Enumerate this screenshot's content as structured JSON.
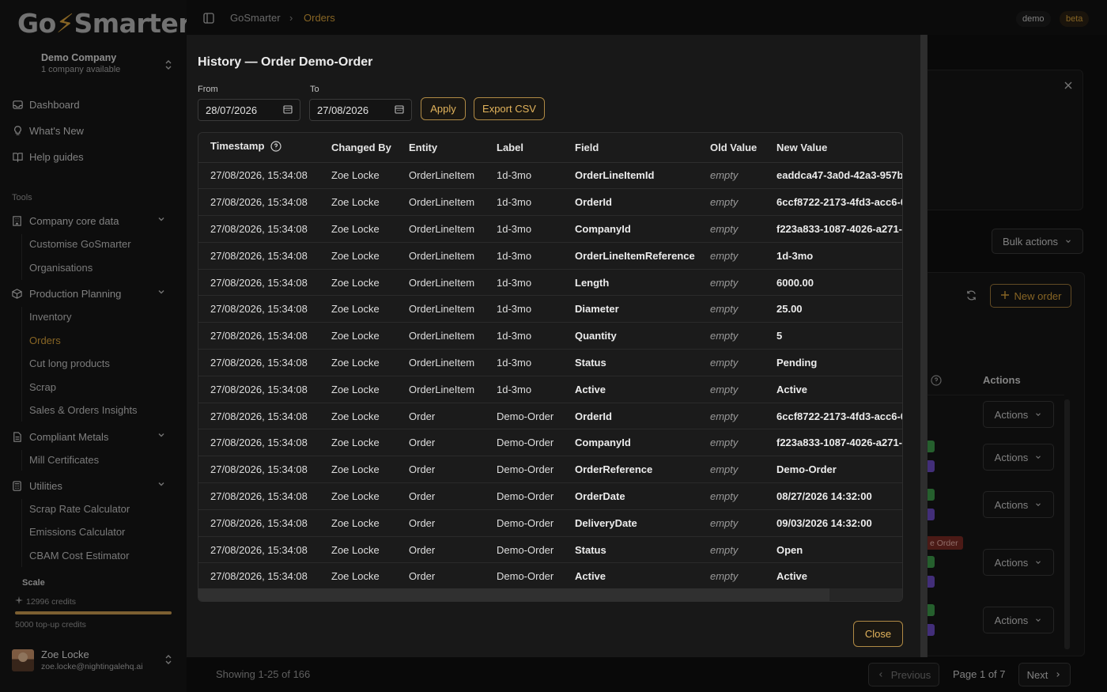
{
  "sidebar": {
    "logo": {
      "pre": "Go",
      "bolt": "⚡",
      "post": "Smarter"
    },
    "company": {
      "name": "Demo Company",
      "sub": "1 company available"
    },
    "nav": [
      {
        "label": "Dashboard",
        "icon": "inbox-icon"
      },
      {
        "label": "What's New",
        "icon": "lightbulb-icon"
      },
      {
        "label": "Help guides",
        "icon": "book-icon"
      }
    ],
    "tools_title": "Tools",
    "groups": {
      "company_core": {
        "label": "Company core data",
        "items": [
          "Customise GoSmarter",
          "Organisations"
        ]
      },
      "production": {
        "label": "Production Planning",
        "items": [
          "Inventory",
          "Orders",
          "Cut long products",
          "Scrap",
          "Sales & Orders Insights"
        ]
      },
      "compliant": {
        "label": "Compliant Metals",
        "items": [
          "Mill Certificates"
        ]
      },
      "utilities": {
        "label": "Utilities",
        "items": [
          "Scrap Rate Calculator",
          "Emissions Calculator",
          "CBAM Cost Estimator"
        ]
      }
    },
    "scale": {
      "title": "Scale",
      "credits": "12996 credits",
      "progress": 1.0,
      "topup": "5000 top-up credits"
    },
    "user": {
      "name": "Zoe Locke",
      "email": "zoe.locke@nightingalehq.ai"
    }
  },
  "topbar": {
    "breadcrumb": [
      "GoSmarter",
      "Orders"
    ],
    "separator": "›",
    "demo": "demo",
    "beta": "beta"
  },
  "background": {
    "bulk_actions": "Bulk actions",
    "new_order": "New order",
    "actions_header": "Actions",
    "actions_label": "Actions",
    "order_tag": "e Order",
    "showing": "Showing 1-25 of 166",
    "previous": "Previous",
    "page": "Page 1 of 7",
    "next": "Next"
  },
  "modal": {
    "title": "History — Order Demo-Order",
    "from_label": "From",
    "from_value": "28/07/2026",
    "to_label": "To",
    "to_value": "27/08/2026",
    "apply": "Apply",
    "export": "Export CSV",
    "close": "Close",
    "columns": [
      "Timestamp",
      "Changed By",
      "Entity",
      "Label",
      "Field",
      "Old Value",
      "New Value"
    ],
    "rows": [
      [
        "27/08/2026, 15:34:08",
        "Zoe Locke",
        "OrderLineItem",
        "1d-3mo",
        "OrderLineItemId",
        "empty",
        "eaddca47-3a0d-42a3-957b-"
      ],
      [
        "27/08/2026, 15:34:08",
        "Zoe Locke",
        "OrderLineItem",
        "1d-3mo",
        "OrderId",
        "empty",
        "6ccf8722-2173-4fd3-acc6-0"
      ],
      [
        "27/08/2026, 15:34:08",
        "Zoe Locke",
        "OrderLineItem",
        "1d-3mo",
        "CompanyId",
        "empty",
        "f223a833-1087-4026-a271-"
      ],
      [
        "27/08/2026, 15:34:08",
        "Zoe Locke",
        "OrderLineItem",
        "1d-3mo",
        "OrderLineItemReference",
        "empty",
        "1d-3mo"
      ],
      [
        "27/08/2026, 15:34:08",
        "Zoe Locke",
        "OrderLineItem",
        "1d-3mo",
        "Length",
        "empty",
        "6000.00"
      ],
      [
        "27/08/2026, 15:34:08",
        "Zoe Locke",
        "OrderLineItem",
        "1d-3mo",
        "Diameter",
        "empty",
        "25.00"
      ],
      [
        "27/08/2026, 15:34:08",
        "Zoe Locke",
        "OrderLineItem",
        "1d-3mo",
        "Quantity",
        "empty",
        "5"
      ],
      [
        "27/08/2026, 15:34:08",
        "Zoe Locke",
        "OrderLineItem",
        "1d-3mo",
        "Status",
        "empty",
        "Pending"
      ],
      [
        "27/08/2026, 15:34:08",
        "Zoe Locke",
        "OrderLineItem",
        "1d-3mo",
        "Active",
        "empty",
        "Active"
      ],
      [
        "27/08/2026, 15:34:08",
        "Zoe Locke",
        "Order",
        "Demo-Order",
        "OrderId",
        "empty",
        "6ccf8722-2173-4fd3-acc6-0"
      ],
      [
        "27/08/2026, 15:34:08",
        "Zoe Locke",
        "Order",
        "Demo-Order",
        "CompanyId",
        "empty",
        "f223a833-1087-4026-a271-"
      ],
      [
        "27/08/2026, 15:34:08",
        "Zoe Locke",
        "Order",
        "Demo-Order",
        "OrderReference",
        "empty",
        "Demo-Order"
      ],
      [
        "27/08/2026, 15:34:08",
        "Zoe Locke",
        "Order",
        "Demo-Order",
        "OrderDate",
        "empty",
        "08/27/2026 14:32:00"
      ],
      [
        "27/08/2026, 15:34:08",
        "Zoe Locke",
        "Order",
        "Demo-Order",
        "DeliveryDate",
        "empty",
        "09/03/2026 14:32:00"
      ],
      [
        "27/08/2026, 15:34:08",
        "Zoe Locke",
        "Order",
        "Demo-Order",
        "Status",
        "empty",
        "Open"
      ],
      [
        "27/08/2026, 15:34:08",
        "Zoe Locke",
        "Order",
        "Demo-Order",
        "Active",
        "empty",
        "Active"
      ]
    ]
  },
  "colors": {
    "accent": "#d9a23b",
    "bg": "#141414",
    "modal": "#181818"
  }
}
